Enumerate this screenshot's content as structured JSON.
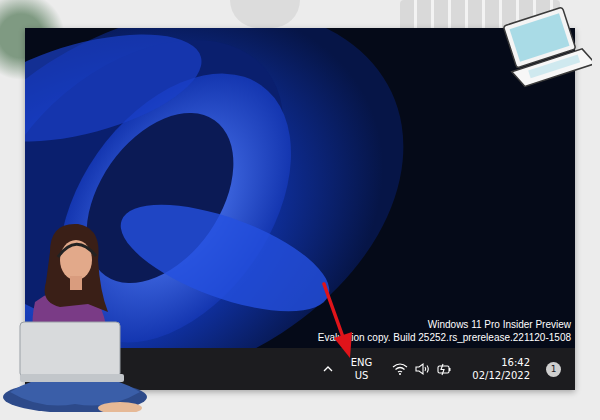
{
  "desktop": {
    "watermark": [
      "Windows 11 Pro Insider Preview",
      "Evaluation copy. Build 25252.rs_prerelease.221120-1508"
    ]
  },
  "taskbar": {
    "language": [
      "ENG",
      "US"
    ],
    "clock": {
      "time": "16:42",
      "date": "02/12/2022"
    },
    "notification_badge": "1"
  }
}
